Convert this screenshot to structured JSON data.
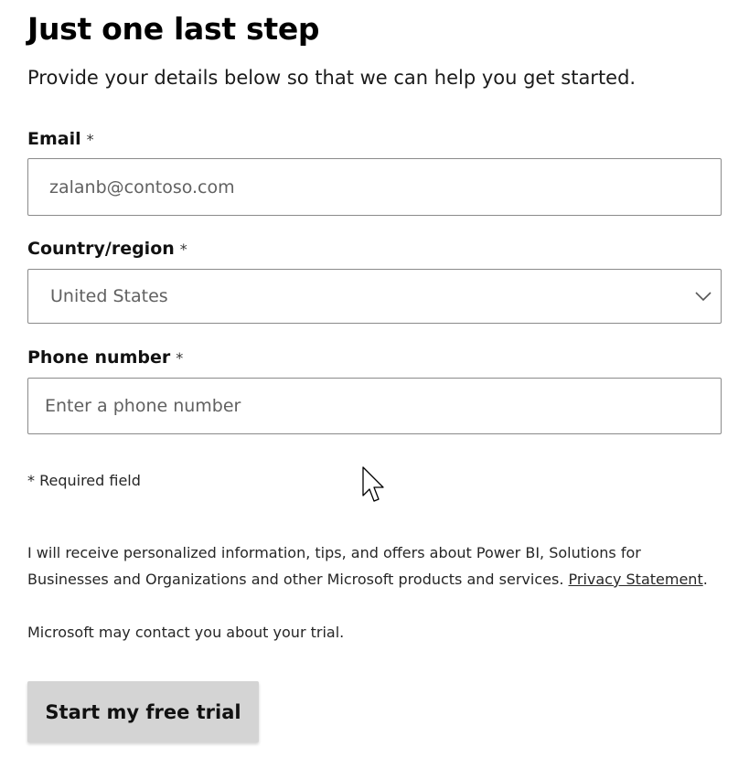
{
  "header": {
    "title": "Just one last step",
    "subtitle": "Provide your details below so that we can help you get started."
  },
  "form": {
    "email": {
      "label": "Email",
      "required_marker": "*",
      "value": "zalanb@contoso.com"
    },
    "country": {
      "label": "Country/region",
      "required_marker": "*",
      "selected": "United States",
      "icon": "chevron-down-icon"
    },
    "phone": {
      "label": "Phone number",
      "required_marker": "*",
      "value": "",
      "placeholder": "Enter a phone number"
    },
    "required_note": "* Required field"
  },
  "consent": {
    "text": "I will receive personalized information, tips, and offers about Power BI, Solutions for Businesses and Organizations and other Microsoft products and services.",
    "link_label": "Privacy Statement",
    "period": "."
  },
  "contact_note": "Microsoft may contact you about your trial.",
  "actions": {
    "submit_label": "Start my free trial"
  },
  "colors": {
    "field_border": "#8a8a8a",
    "button_background": "#d4d4d4",
    "placeholder_text": "#616161"
  }
}
